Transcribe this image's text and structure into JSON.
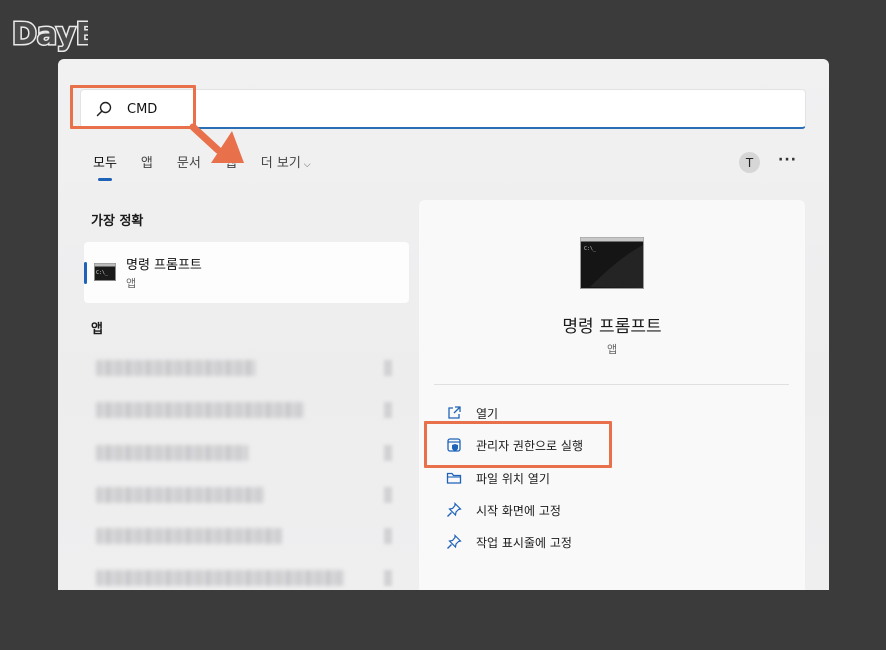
{
  "watermark": "DayB",
  "search": {
    "value": "CMD"
  },
  "tabs": [
    {
      "label": "모두",
      "active": true
    },
    {
      "label": "앱"
    },
    {
      "label": "문서"
    },
    {
      "label": "웹"
    },
    {
      "label": "더 보기"
    }
  ],
  "user_initial": "T",
  "more_label": "···",
  "best_match": {
    "heading": "가장 정확",
    "title": "명령 프롬프트",
    "subtitle": "앱"
  },
  "apps_heading": "앱",
  "detail": {
    "title": "명령 프롬프트",
    "subtitle": "앱",
    "actions": [
      {
        "label": "열기",
        "icon": "open-external-icon"
      },
      {
        "label": "관리자 권한으로 실행",
        "icon": "shield-icon"
      },
      {
        "label": "파일 위치 열기",
        "icon": "folder-icon"
      },
      {
        "label": "시작 화면에 고정",
        "icon": "pin-icon"
      },
      {
        "label": "작업 표시줄에 고정",
        "icon": "pin-icon"
      }
    ]
  },
  "colors": {
    "accent": "#1e63b8",
    "highlight": "#e8704a",
    "background": "#3b3b3b"
  }
}
